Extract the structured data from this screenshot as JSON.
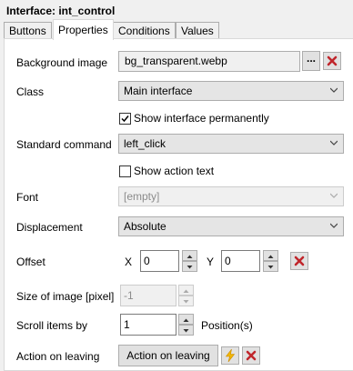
{
  "window_title": "Interface: int_control",
  "tabs": [
    {
      "label": "Buttons"
    },
    {
      "label": "Properties"
    },
    {
      "label": "Conditions"
    },
    {
      "label": "Values"
    }
  ],
  "active_tab": "Properties",
  "form": {
    "background_image": {
      "label": "Background image",
      "value": "bg_transparent.webp",
      "browse_label": "..."
    },
    "class": {
      "label": "Class",
      "value": "Main interface"
    },
    "show_permanently": {
      "label": "Show interface permanently",
      "checked": true
    },
    "standard_command": {
      "label": "Standard command",
      "value": "left_click"
    },
    "show_action_text": {
      "label": "Show action text",
      "checked": false
    },
    "font": {
      "label": "Font",
      "value": "[empty]",
      "enabled": false
    },
    "displacement": {
      "label": "Displacement",
      "value": "Absolute"
    },
    "offset": {
      "label": "Offset",
      "x_label": "X",
      "x_value": "0",
      "y_label": "Y",
      "y_value": "0"
    },
    "size_of_image": {
      "label": "Size of image [pixel]",
      "value": "-1",
      "enabled": false
    },
    "scroll_items": {
      "label": "Scroll items by",
      "value": "1",
      "unit_label": "Position(s)"
    },
    "action_on_leaving": {
      "label": "Action on leaving",
      "button_label": "Action on leaving"
    }
  },
  "colors": {
    "clear_red": "#c0262c",
    "lightning": "#f2b705"
  },
  "icons": {
    "clear": "red-x-icon",
    "dropdown": "chevron-down-icon",
    "lightning": "lightning-icon"
  }
}
